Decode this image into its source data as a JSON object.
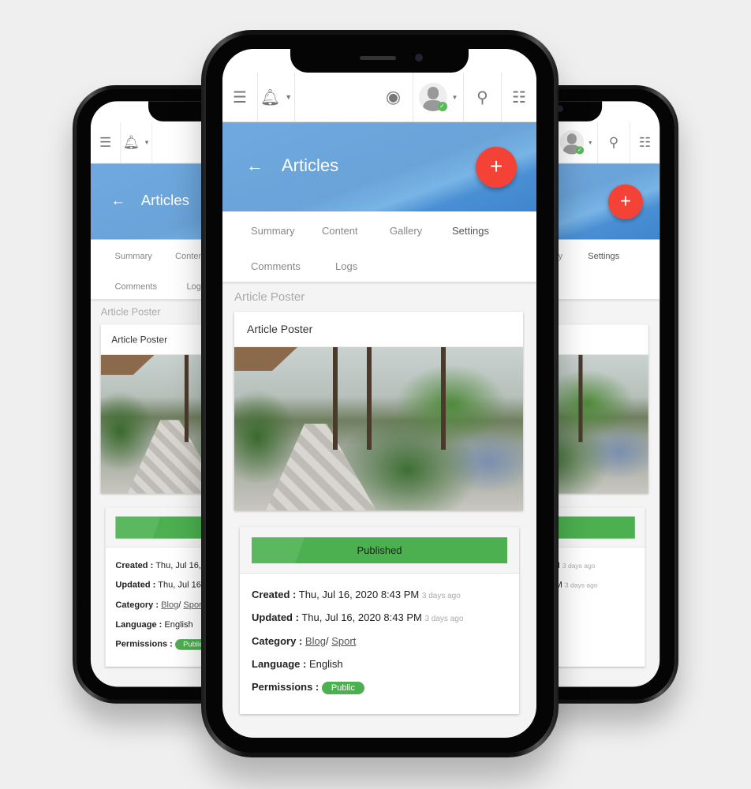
{
  "toolbar": {
    "menu_icon": "hamburger-menu-icon",
    "bell_icon": "bell-icon",
    "eye_icon": "eye-icon",
    "avatar_icon": "user-avatar-icon",
    "search_icon": "search-icon",
    "list_icon": "list-icon"
  },
  "header": {
    "back": "←",
    "title": "Articles",
    "fab": "+",
    "color": "#6aa3d8",
    "fab_color": "#f44336"
  },
  "tabs": [
    "Summary",
    "Content",
    "Gallery",
    "Settings",
    "Comments",
    "Logs"
  ],
  "section_title": "Article Poster",
  "poster_card": {
    "title": "Article Poster"
  },
  "details": {
    "status": "Published",
    "created_label": "Created :",
    "created": "Thu, Jul 16, 2020 8:43 PM",
    "created_ago": "3 days ago",
    "updated_label": "Updated :",
    "updated": "Thu, Jul 16, 2020 8:43 PM",
    "updated_ago": "3 days ago",
    "category_label": "Category :",
    "category_1": "Blog",
    "category_sep": "/",
    "category_2": "Sport",
    "language_label": "Language :",
    "language": "English",
    "permissions_label": "Permissions :",
    "permissions": "Public",
    "status_color": "#4caf50"
  }
}
